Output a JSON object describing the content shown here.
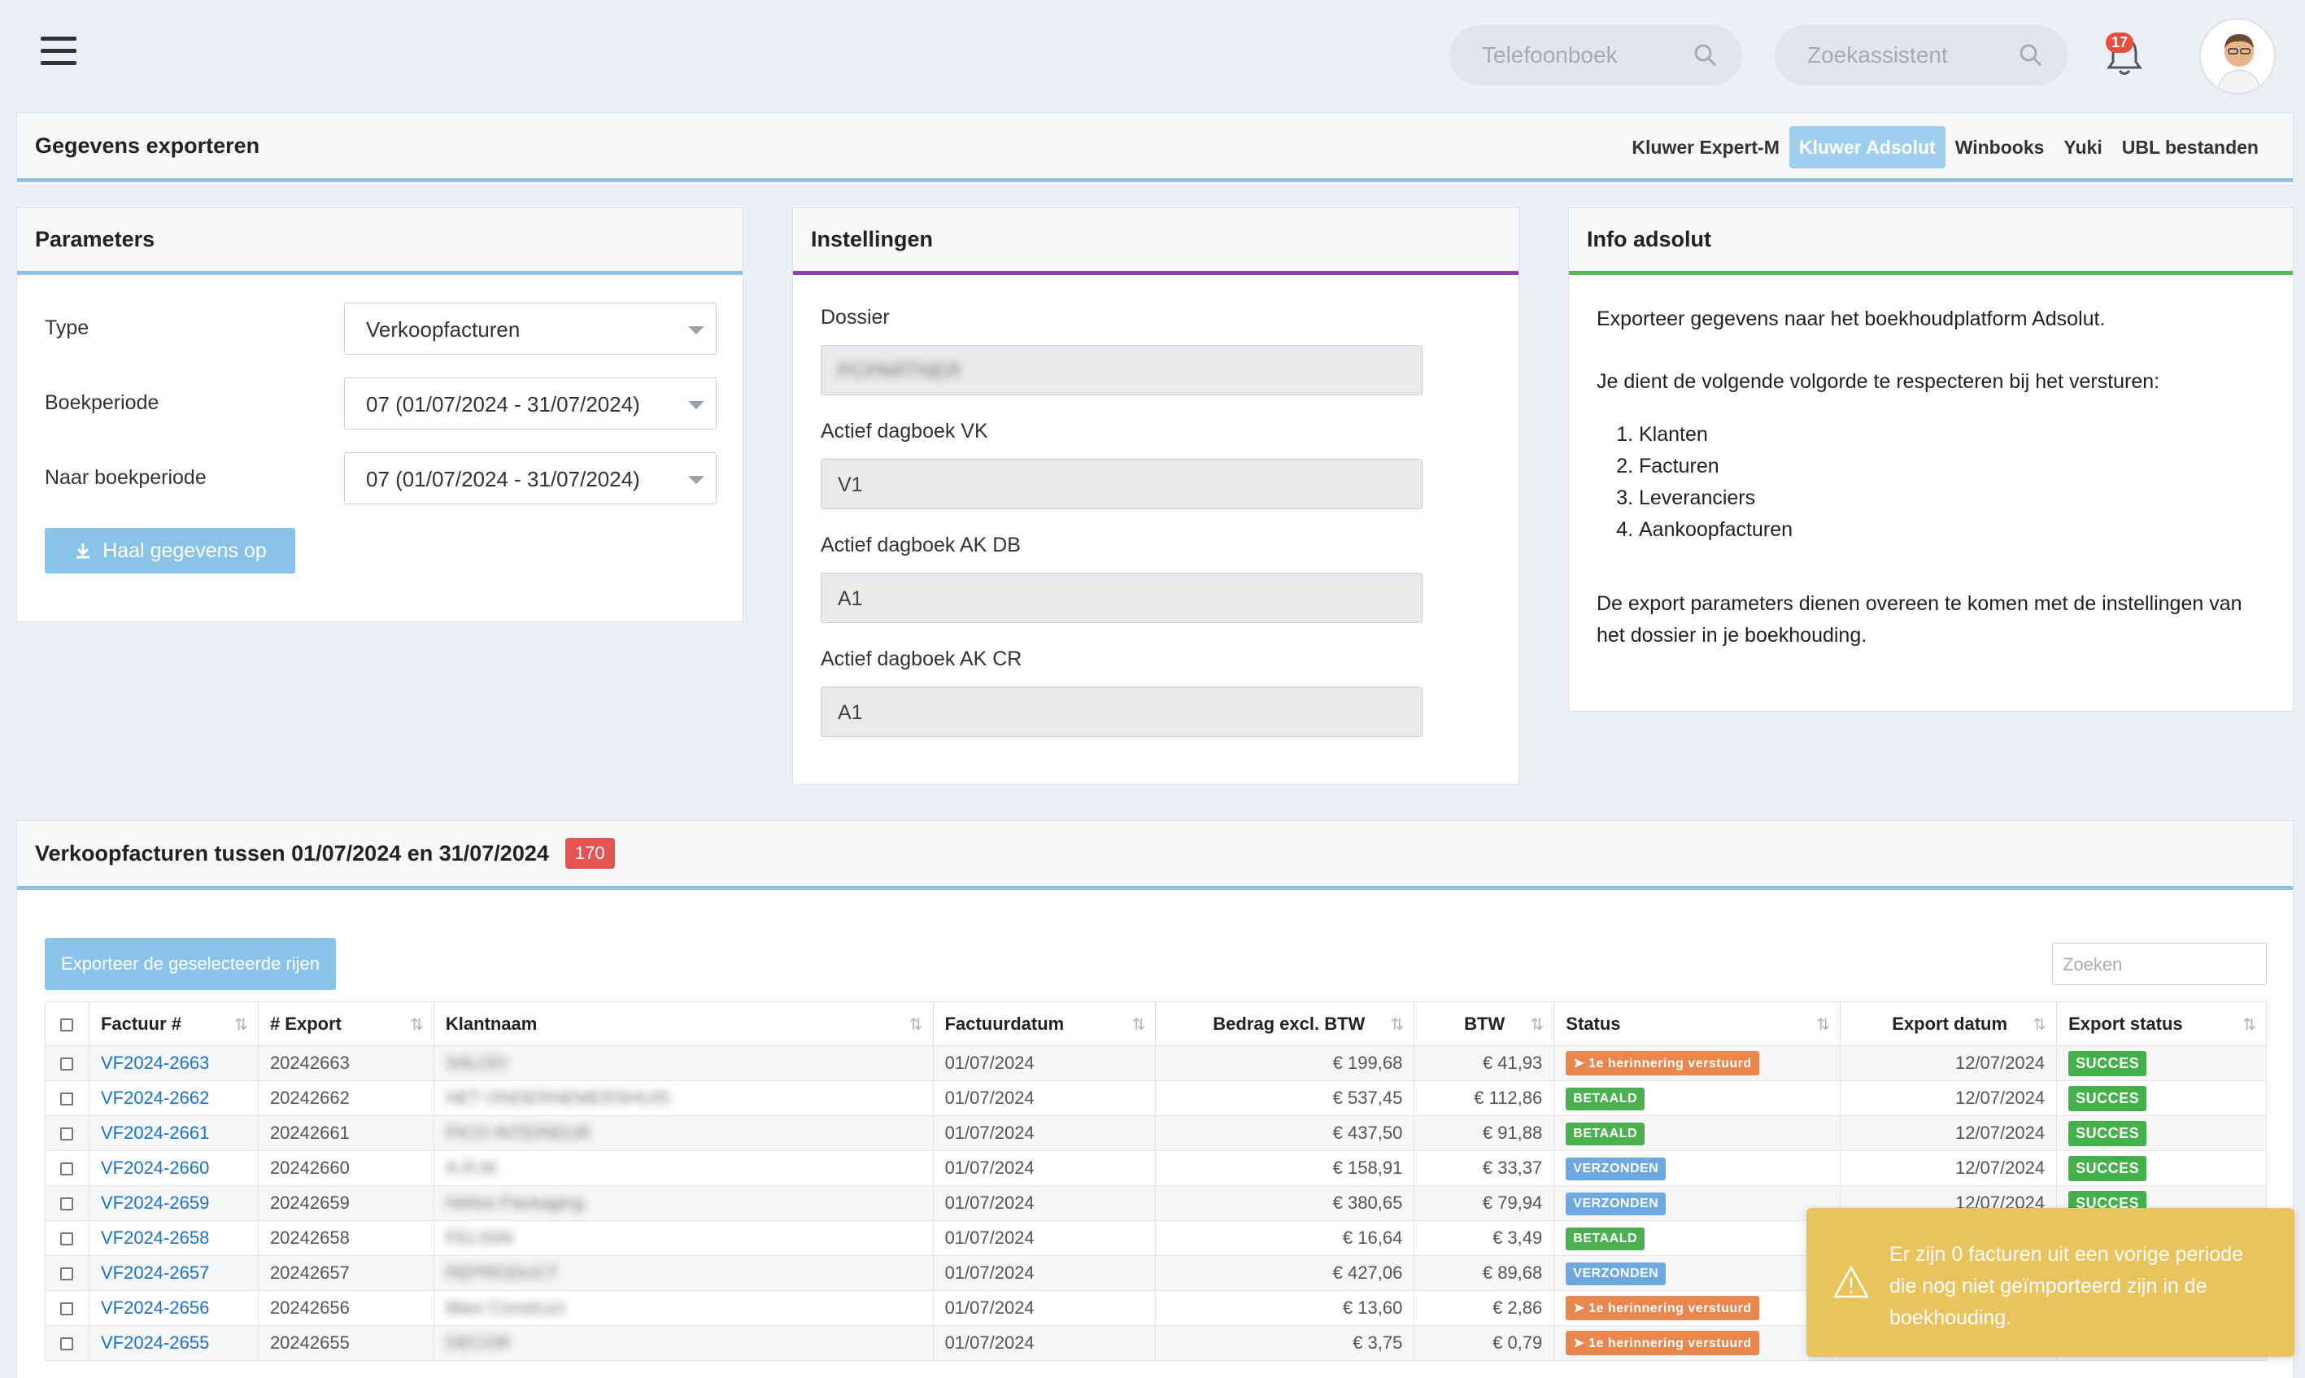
{
  "topbar": {
    "search1_placeholder": "Telefoonboek",
    "search2_placeholder": "Zoekassistent",
    "notifications_count": "17"
  },
  "header": {
    "title": "Gegevens exporteren",
    "tabs": [
      "Kluwer Expert-M",
      "Kluwer Adsolut",
      "Winbooks",
      "Yuki",
      "UBL bestanden"
    ],
    "active_tab": "Kluwer Adsolut"
  },
  "parameters": {
    "title": "Parameters",
    "type_label": "Type",
    "type_value": "Verkoopfacturen",
    "period_label": "Boekperiode",
    "period_value": "07 (01/07/2024 - 31/07/2024)",
    "to_period_label": "Naar boekperiode",
    "to_period_value": "07 (01/07/2024 - 31/07/2024)",
    "fetch_button": "Haal gegevens op"
  },
  "settings": {
    "title": "Instellingen",
    "dossier_label": "Dossier",
    "dossier_value": "PCPARTNER",
    "vk_label": "Actief dagboek VK",
    "vk_value": "V1",
    "akdb_label": "Actief dagboek AK DB",
    "akdb_value": "A1",
    "akcr_label": "Actief dagboek AK CR",
    "akcr_value": "A1"
  },
  "info": {
    "title": "Info adsolut",
    "line1": "Exporteer gegevens naar het boekhoudplatform Adsolut.",
    "line2": "Je dient de volgende volgorde te respecteren bij het versturen:",
    "steps": [
      "Klanten",
      "Facturen",
      "Leveranciers",
      "Aankoopfacturen"
    ],
    "line3": "De export parameters dienen overeen te komen met de instellingen van het dossier in je boekhouding."
  },
  "table_panel": {
    "title": "Verkoopfacturen tussen 01/07/2024 en 31/07/2024",
    "count": "170",
    "export_button": "Exporteer de geselecteerde rijen",
    "search_placeholder": "Zoeken",
    "columns": [
      "Factuur #",
      "# Export",
      "Klantnaam",
      "Factuurdatum",
      "Bedrag excl. BTW",
      "BTW",
      "Status",
      "Export datum",
      "Export status"
    ],
    "rows": [
      {
        "invoice": "VF2024-2663",
        "export": "20242663",
        "client": "SALOO",
        "date": "01/07/2024",
        "amount": "€ 199,68",
        "vat": "€ 41,93",
        "status": "1e herinnering verstuurd",
        "status_type": "orange",
        "export_date": "12/07/2024",
        "export_status": "SUCCES"
      },
      {
        "invoice": "VF2024-2662",
        "export": "20242662",
        "client": "HET ONDERNEMERSHUIS",
        "date": "01/07/2024",
        "amount": "€ 537,45",
        "vat": "€ 112,86",
        "status": "BETAALD",
        "status_type": "green",
        "export_date": "12/07/2024",
        "export_status": "SUCCES"
      },
      {
        "invoice": "VF2024-2661",
        "export": "20242661",
        "client": "PICO INTERIEUR",
        "date": "01/07/2024",
        "amount": "€ 437,50",
        "vat": "€ 91,88",
        "status": "BETAALD",
        "status_type": "green",
        "export_date": "12/07/2024",
        "export_status": "SUCCES"
      },
      {
        "invoice": "VF2024-2660",
        "export": "20242660",
        "client": "A.R.M.",
        "date": "01/07/2024",
        "amount": "€ 158,91",
        "vat": "€ 33,37",
        "status": "VERZONDEN",
        "status_type": "blue",
        "export_date": "12/07/2024",
        "export_status": "SUCCES"
      },
      {
        "invoice": "VF2024-2659",
        "export": "20242659",
        "client": "Helios Packaging",
        "date": "01/07/2024",
        "amount": "€ 380,65",
        "vat": "€ 79,94",
        "status": "VERZONDEN",
        "status_type": "blue",
        "export_date": "12/07/2024",
        "export_status": "SUCCES"
      },
      {
        "invoice": "VF2024-2658",
        "export": "20242658",
        "client": "FELISIN",
        "date": "01/07/2024",
        "amount": "€ 16,64",
        "vat": "€ 3,49",
        "status": "BETAALD",
        "status_type": "green",
        "export_date": "",
        "export_status": ""
      },
      {
        "invoice": "VF2024-2657",
        "export": "20242657",
        "client": "REPRODUCT",
        "date": "01/07/2024",
        "amount": "€ 427,06",
        "vat": "€ 89,68",
        "status": "VERZONDEN",
        "status_type": "blue",
        "export_date": "",
        "export_status": ""
      },
      {
        "invoice": "VF2024-2656",
        "export": "20242656",
        "client": "Maxi Construct",
        "date": "01/07/2024",
        "amount": "€ 13,60",
        "vat": "€ 2,86",
        "status": "1e herinnering verstuurd",
        "status_type": "orange",
        "export_date": "",
        "export_status": ""
      },
      {
        "invoice": "VF2024-2655",
        "export": "20242655",
        "client": "DECOR",
        "date": "01/07/2024",
        "amount": "€ 3,75",
        "vat": "€ 0,79",
        "status": "1e herinnering verstuurd",
        "status_type": "orange",
        "export_date": "",
        "export_status": ""
      }
    ]
  },
  "toast": {
    "message": "Er zijn 0 facturen uit een vorige periode die nog niet geïmporteerd zijn in de boekhouding."
  },
  "colors": {
    "accent_blue": "#8fc3e5",
    "accent_purple": "#8e44ad",
    "accent_green": "#5cb85c",
    "toast_yellow": "#e8c35e"
  }
}
